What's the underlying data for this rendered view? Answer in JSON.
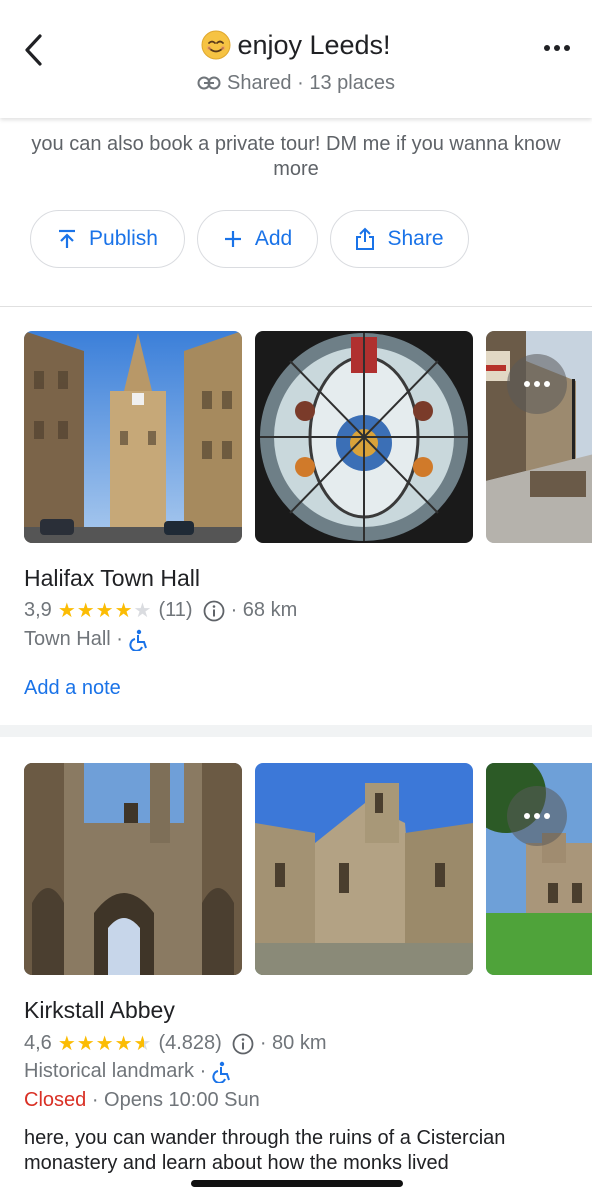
{
  "header": {
    "title": "enjoy Leeds!",
    "shared_label": "Shared",
    "places_count": "· 13 places"
  },
  "description": "you can also book a private tour! DM me if you wanna know more",
  "actions": {
    "publish": "Publish",
    "add": "Add",
    "share": "Share"
  },
  "places": [
    {
      "name": "Halifax Town Hall",
      "rating": "3,9",
      "stars": 3.9,
      "reviews": "(11)",
      "distance": "· 68 km",
      "category": "Town Hall ·",
      "note_link": "Add a note"
    },
    {
      "name": "Kirkstall Abbey",
      "rating": "4,6",
      "stars": 4.6,
      "reviews": "(4.828)",
      "distance": "· 80 km",
      "category": "Historical landmark ·",
      "status_closed": "Closed",
      "status_opens": "· Opens 10:00 Sun",
      "note": "here, you can wander through the ruins of a Cistercian monastery and learn about how the monks lived"
    }
  ],
  "colors": {
    "accent": "#1a73e8",
    "star": "#fbbc04",
    "closed": "#d93025",
    "muted": "#70757a"
  }
}
